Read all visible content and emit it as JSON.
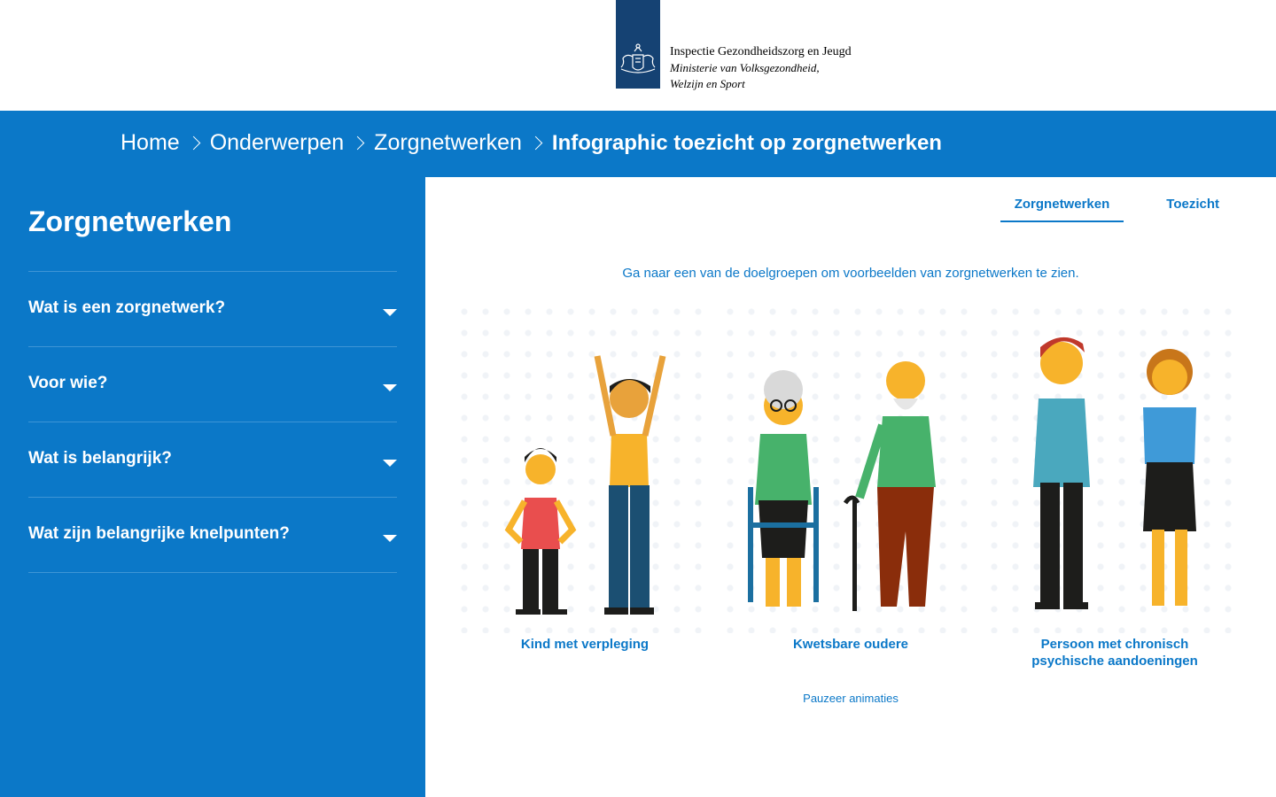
{
  "header": {
    "org_line1": "Inspectie Gezondheidszorg en Jeugd",
    "org_line2": "Ministerie van Volksgezondheid,",
    "org_line3": "Welzijn en Sport"
  },
  "breadcrumb": {
    "items": [
      "Home",
      "Onderwerpen",
      "Zorgnetwerken"
    ],
    "current": "Infographic toezicht op zorgnetwerken"
  },
  "sidebar": {
    "title": "Zorgnetwerken",
    "items": [
      {
        "label": "Wat is een zorgnetwerk?"
      },
      {
        "label": "Voor wie?"
      },
      {
        "label": "Wat is belangrijk?"
      },
      {
        "label": "Wat zijn belangrijke knelpunten?"
      }
    ]
  },
  "main": {
    "tabs": [
      {
        "label": "Zorgnetwerken",
        "active": true
      },
      {
        "label": "Toezicht",
        "active": false
      }
    ],
    "intro": "Ga naar een van de doelgroepen om voorbeelden van zorgnetwerken te zien.",
    "groups": [
      {
        "caption": "Kind met verpleging"
      },
      {
        "caption": "Kwetsbare oudere"
      },
      {
        "caption_line1": "Persoon met chronisch",
        "caption_line2": "psychische aandoeningen"
      }
    ],
    "pause_label": "Pauzeer animaties"
  },
  "colors": {
    "brand_blue": "#0b78c8",
    "logo_navy": "#154273"
  }
}
